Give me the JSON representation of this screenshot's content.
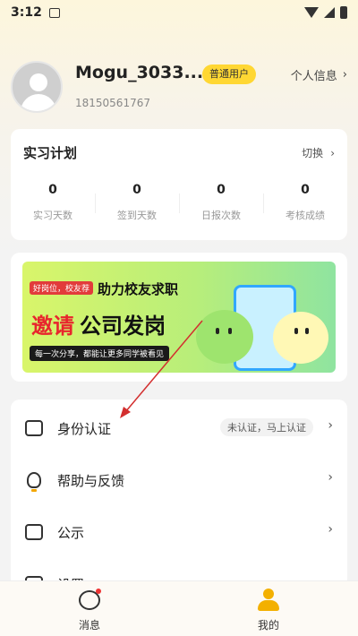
{
  "status_bar": {
    "time": "3:12"
  },
  "profile": {
    "username": "Mogu_3033...",
    "badge": "普通用户",
    "phone": "18150561767",
    "info_link": "个人信息"
  },
  "plan": {
    "title": "实习计划",
    "switch_label": "切换",
    "stats": [
      {
        "value": "0",
        "label": "实习天数"
      },
      {
        "value": "0",
        "label": "签到天数"
      },
      {
        "value": "0",
        "label": "日报次数"
      },
      {
        "value": "0",
        "label": "考核成绩"
      }
    ]
  },
  "banner": {
    "tag": "好岗位，校友荐",
    "line1": "助力校友求职",
    "line2_red": "邀请",
    "line2_black": "公司发岗",
    "subtitle": "每一次分享，都能让更多同学被看见"
  },
  "menu": {
    "items": [
      {
        "label": "身份认证",
        "badge": "未认证，马上认证"
      },
      {
        "label": "帮助与反馈"
      },
      {
        "label": "公示"
      },
      {
        "label": "设置"
      }
    ]
  },
  "tabbar": {
    "tabs": [
      {
        "label": "消息"
      },
      {
        "label": "我的"
      }
    ]
  },
  "colors": {
    "accent": "#f3b000",
    "badge_bg": "#ffd733",
    "arrow": "#d32f2f"
  }
}
